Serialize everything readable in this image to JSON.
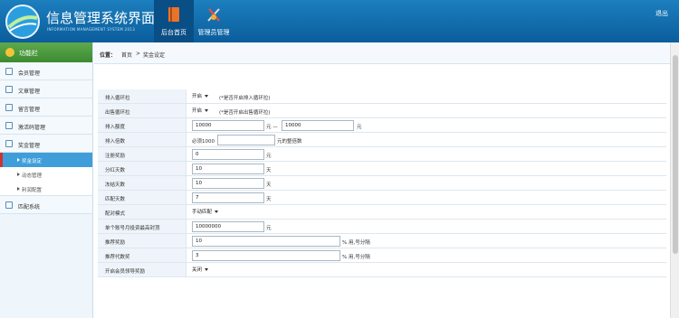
{
  "header": {
    "title": "信息管理系统界面",
    "subtitle": "INFORMATION MANAGEMENT SYSTEM  2013",
    "tabs": [
      {
        "label": "后台首页",
        "icon": "book-icon"
      },
      {
        "label": "管理员管理",
        "icon": "tools-icon"
      }
    ],
    "logout": "退出",
    "color": "#0b5d9c"
  },
  "sidebar": {
    "head": "功能栏",
    "items": [
      "会员管理",
      "文章管理",
      "留言管理",
      "激活码管理",
      "奖金管理"
    ],
    "subitems": [
      "奖金设定",
      "动态管理",
      "利润配置"
    ],
    "last": "匹配系统"
  },
  "crumb": {
    "prefix": "位置：",
    "home": "首页",
    "sep": ">",
    "current": "奖金设定"
  },
  "rows": [
    {
      "label": "排入循环拉",
      "select": "开启",
      "note": "(*是否开启排入循环拉)"
    },
    {
      "label": "出售循环拉",
      "select": "开启",
      "note": "(*是否开启出售循环拉)"
    },
    {
      "label": "排入额度",
      "v1": "10000",
      "mid": "元 —",
      "v2": "10000",
      "unit": "元"
    },
    {
      "label": "排入倍数",
      "pre": "必须1000",
      "unit": "元的整倍数"
    },
    {
      "label": "注册奖励",
      "v1": "0",
      "unit": "元"
    },
    {
      "label": "分红天数",
      "v1": "10",
      "unit": "天"
    },
    {
      "label": "冻结天数",
      "v1": "10",
      "unit": "天"
    },
    {
      "label": "匹配天数",
      "v1": "7",
      "unit": "天"
    },
    {
      "label": "配对模式",
      "select": "手动匹配"
    },
    {
      "label": "单个账号月投资最高封顶",
      "v1": "10000000",
      "unit": "元"
    },
    {
      "label": "推荐奖励",
      "v1": "10",
      "unit": "% 用,号分隔"
    },
    {
      "label": "推荐代数奖",
      "v1": "3",
      "unit": "% 用,号分隔"
    },
    {
      "label": "开启会员领导奖励",
      "select": "关闭"
    }
  ]
}
